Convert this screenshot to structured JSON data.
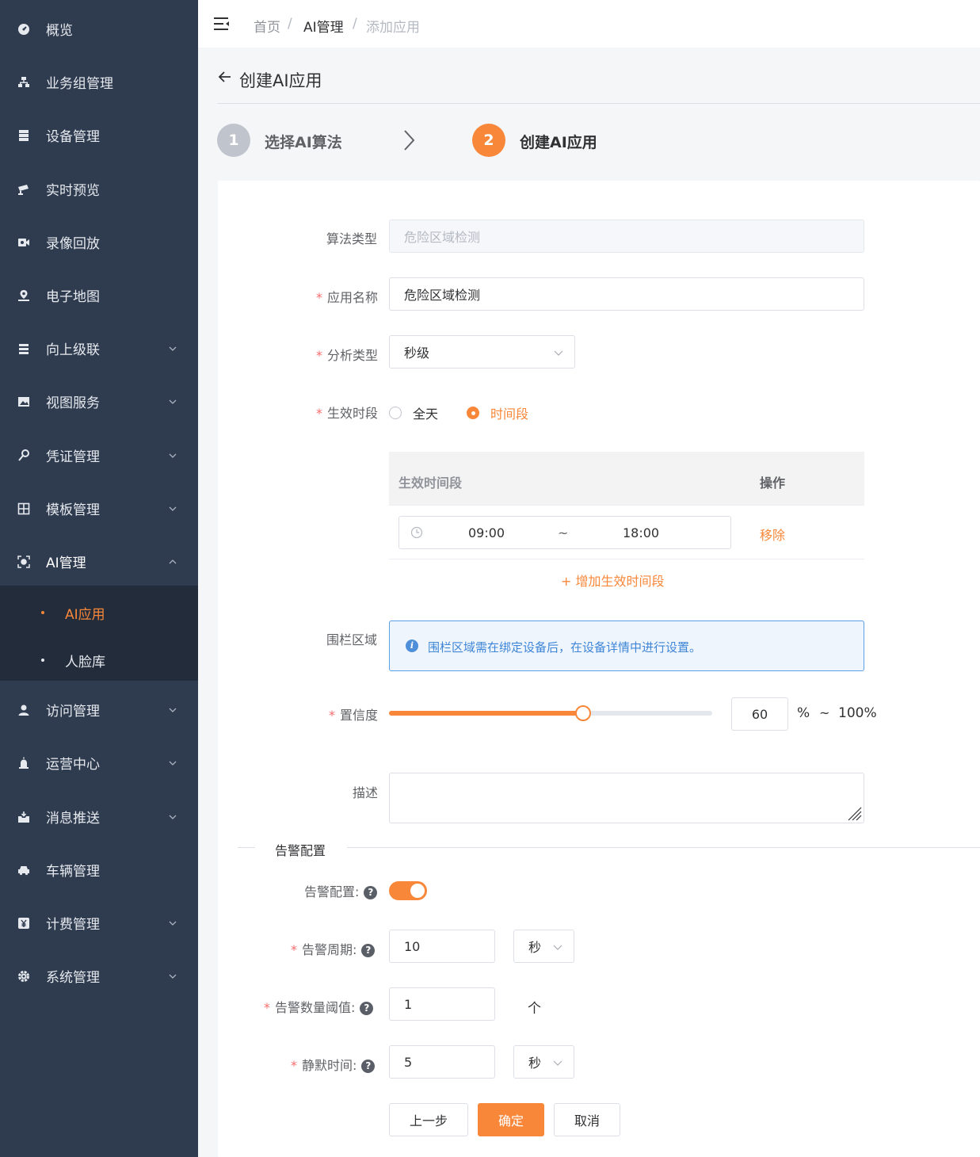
{
  "sidebar": {
    "items": [
      {
        "label": "概览",
        "icon": "dashboard-icon"
      },
      {
        "label": "业务组管理",
        "icon": "org-tree-icon"
      },
      {
        "label": "设备管理",
        "icon": "server-icon"
      },
      {
        "label": "实时预览",
        "icon": "camera-icon"
      },
      {
        "label": "录像回放",
        "icon": "video-icon"
      },
      {
        "label": "电子地图",
        "icon": "map-pin-icon"
      },
      {
        "label": "向上级联",
        "icon": "cascade-icon"
      },
      {
        "label": "视图服务",
        "icon": "image-icon"
      },
      {
        "label": "凭证管理",
        "icon": "key-icon"
      },
      {
        "label": "模板管理",
        "icon": "grid-icon"
      },
      {
        "label": "AI管理",
        "icon": "ai-scan-icon"
      },
      {
        "label": "访问管理",
        "icon": "user-icon"
      },
      {
        "label": "运营中心",
        "icon": "alarm-icon"
      },
      {
        "label": "消息推送",
        "icon": "inbox-icon"
      },
      {
        "label": "车辆管理",
        "icon": "car-icon"
      },
      {
        "label": "计费管理",
        "icon": "yen-icon"
      },
      {
        "label": "系统管理",
        "icon": "gear-icon"
      }
    ],
    "sub_items": [
      {
        "label": "AI应用",
        "active": true
      },
      {
        "label": "人脸库",
        "active": false
      }
    ],
    "accent": "#f8873a",
    "bg": "#2f3c50"
  },
  "header": {
    "breadcrumb": [
      "首页",
      "AI管理",
      "添加应用"
    ],
    "separator": "/"
  },
  "page": {
    "title": "创建AI应用",
    "steps": [
      {
        "num": "1",
        "label": "选择AI算法"
      },
      {
        "num": "2",
        "label": "创建AI应用"
      }
    ]
  },
  "form": {
    "algo_type": {
      "label": "算法类型",
      "value": "危险区域检测"
    },
    "app_name": {
      "label": "应用名称",
      "value": "危险区域检测"
    },
    "analysis_type": {
      "label": "分析类型",
      "value": "秒级"
    },
    "effective_period": {
      "label": "生效时段",
      "options": [
        "全天",
        "时间段"
      ],
      "selected": "时间段"
    },
    "period_table": {
      "col_period": "生效时间段",
      "col_action": "操作",
      "rows": [
        {
          "start": "09:00",
          "sep": "~",
          "end": "18:00",
          "action": "移除"
        }
      ],
      "add_label": "+ 增加生效时间段"
    },
    "fence": {
      "label": "围栏区域",
      "notice": "围栏区域需在绑定设备后，在设备详情中进行设置。"
    },
    "confidence": {
      "label": "置信度",
      "value": "60",
      "percent": 60,
      "unit": "%",
      "sep": "~",
      "max": "100%"
    },
    "description": {
      "label": "描述",
      "value": ""
    }
  },
  "alarm": {
    "section_title": "告警配置",
    "enable": {
      "label": "告警配置:",
      "on": true
    },
    "period": {
      "label": "告警周期:",
      "value": "10",
      "unit": "秒"
    },
    "threshold": {
      "label": "告警数量阈值:",
      "value": "1",
      "unit": "个"
    },
    "silence": {
      "label": "静默时间:",
      "value": "5",
      "unit": "秒"
    }
  },
  "buttons": {
    "prev": "上一步",
    "confirm": "确定",
    "cancel": "取消"
  }
}
